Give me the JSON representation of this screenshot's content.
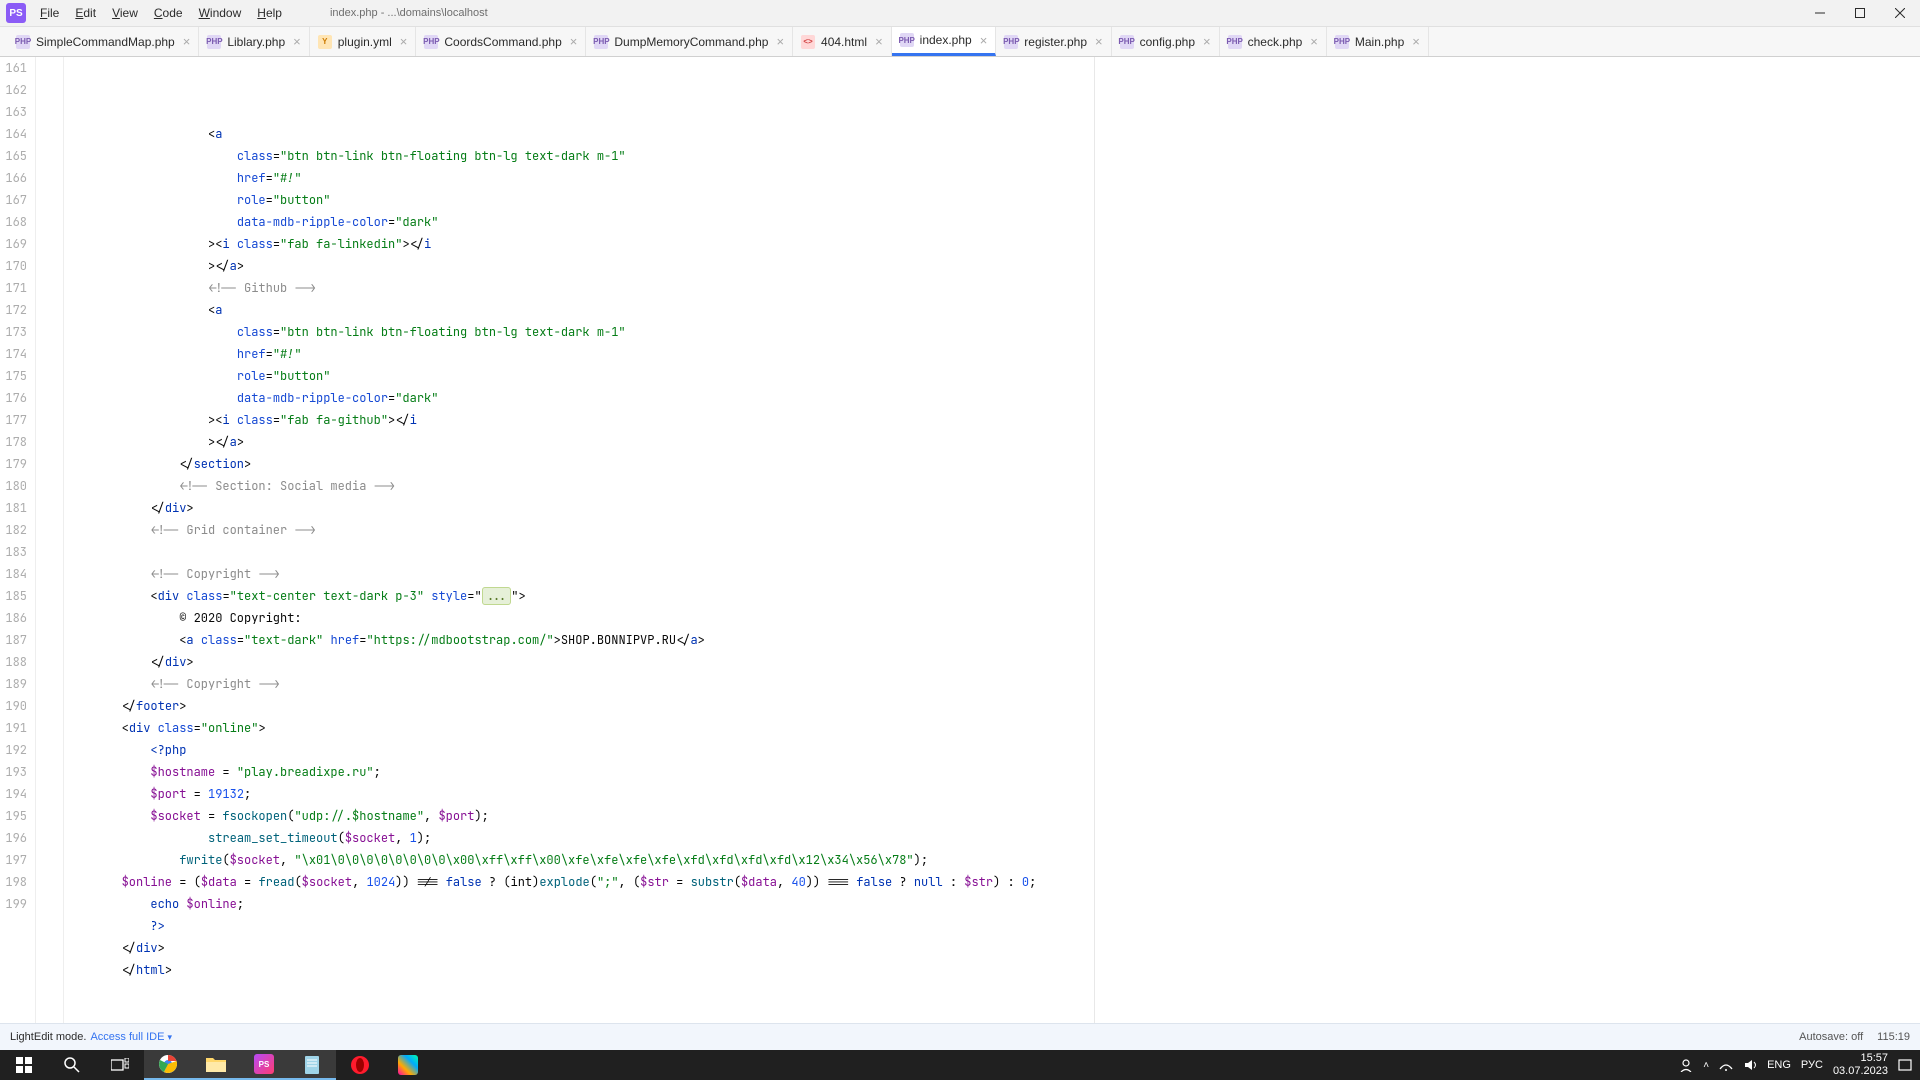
{
  "window": {
    "app_icon": "PS",
    "title": "index.php - ...\\domains\\localhost"
  },
  "menu": {
    "file": "File",
    "edit": "Edit",
    "view": "View",
    "code": "Code",
    "window": "Window",
    "help": "Help"
  },
  "tabs": [
    {
      "label": "SimpleCommandMap.php",
      "type": "php"
    },
    {
      "label": "Liblary.php",
      "type": "php"
    },
    {
      "label": "plugin.yml",
      "type": "yml"
    },
    {
      "label": "CoordsCommand.php",
      "type": "php"
    },
    {
      "label": "DumpMemoryCommand.php",
      "type": "php"
    },
    {
      "label": "404.html",
      "type": "html"
    },
    {
      "label": "index.php",
      "type": "php",
      "active": true
    },
    {
      "label": "register.php",
      "type": "php"
    },
    {
      "label": "config.php",
      "type": "php"
    },
    {
      "label": "check.php",
      "type": "php"
    },
    {
      "label": "Main.php",
      "type": "php"
    }
  ],
  "gutter": {
    "start": 161,
    "end": 199
  },
  "status": {
    "mode": "LightEdit mode.",
    "link": "Access full IDE",
    "autosave": "Autosave: off",
    "pos": "115:19"
  },
  "tray": {
    "lang1": "ENG",
    "lang2": "РУС",
    "time": "15:57",
    "date": "03.07.2023"
  },
  "code_strings": {
    "btn_class": "\"btn btn-link btn-floating btn-lg text-dark m-1\"",
    "href_hash": "\"#!\"",
    "role_btn": "\"button\"",
    "ripple": "\"dark\"",
    "linkedin": "\"fab fa-linkedin\"",
    "github_c": "\"fab fa-github\"",
    "copy_class": "\"text-center text-dark p-3\"",
    "copy_year": "© 2020 Copyright:",
    "text_dark": "\"text-dark\"",
    "mdb_url": "\"https://mdbootstrap.com/\"",
    "shop": "SHOP.BONNIPVP.RU",
    "online": "\"online\"",
    "hostname_v": "\"play.breadixpe.ru\"",
    "port_v": "19132",
    "udp": "\"udp://.$hostname\"",
    "timeout_n": "1",
    "packet": "\"\\x01\\0\\0\\0\\0\\0\\0\\0\\0\\x00\\xff\\xff\\x00\\xfe\\xfe\\xfe\\xfe\\xfd\\xfd\\xfd\\xfd\\x12\\x34\\x56\\x78\"",
    "n1024": "1024",
    "semi": "\";\"",
    "n40": "40",
    "n0": "0"
  }
}
